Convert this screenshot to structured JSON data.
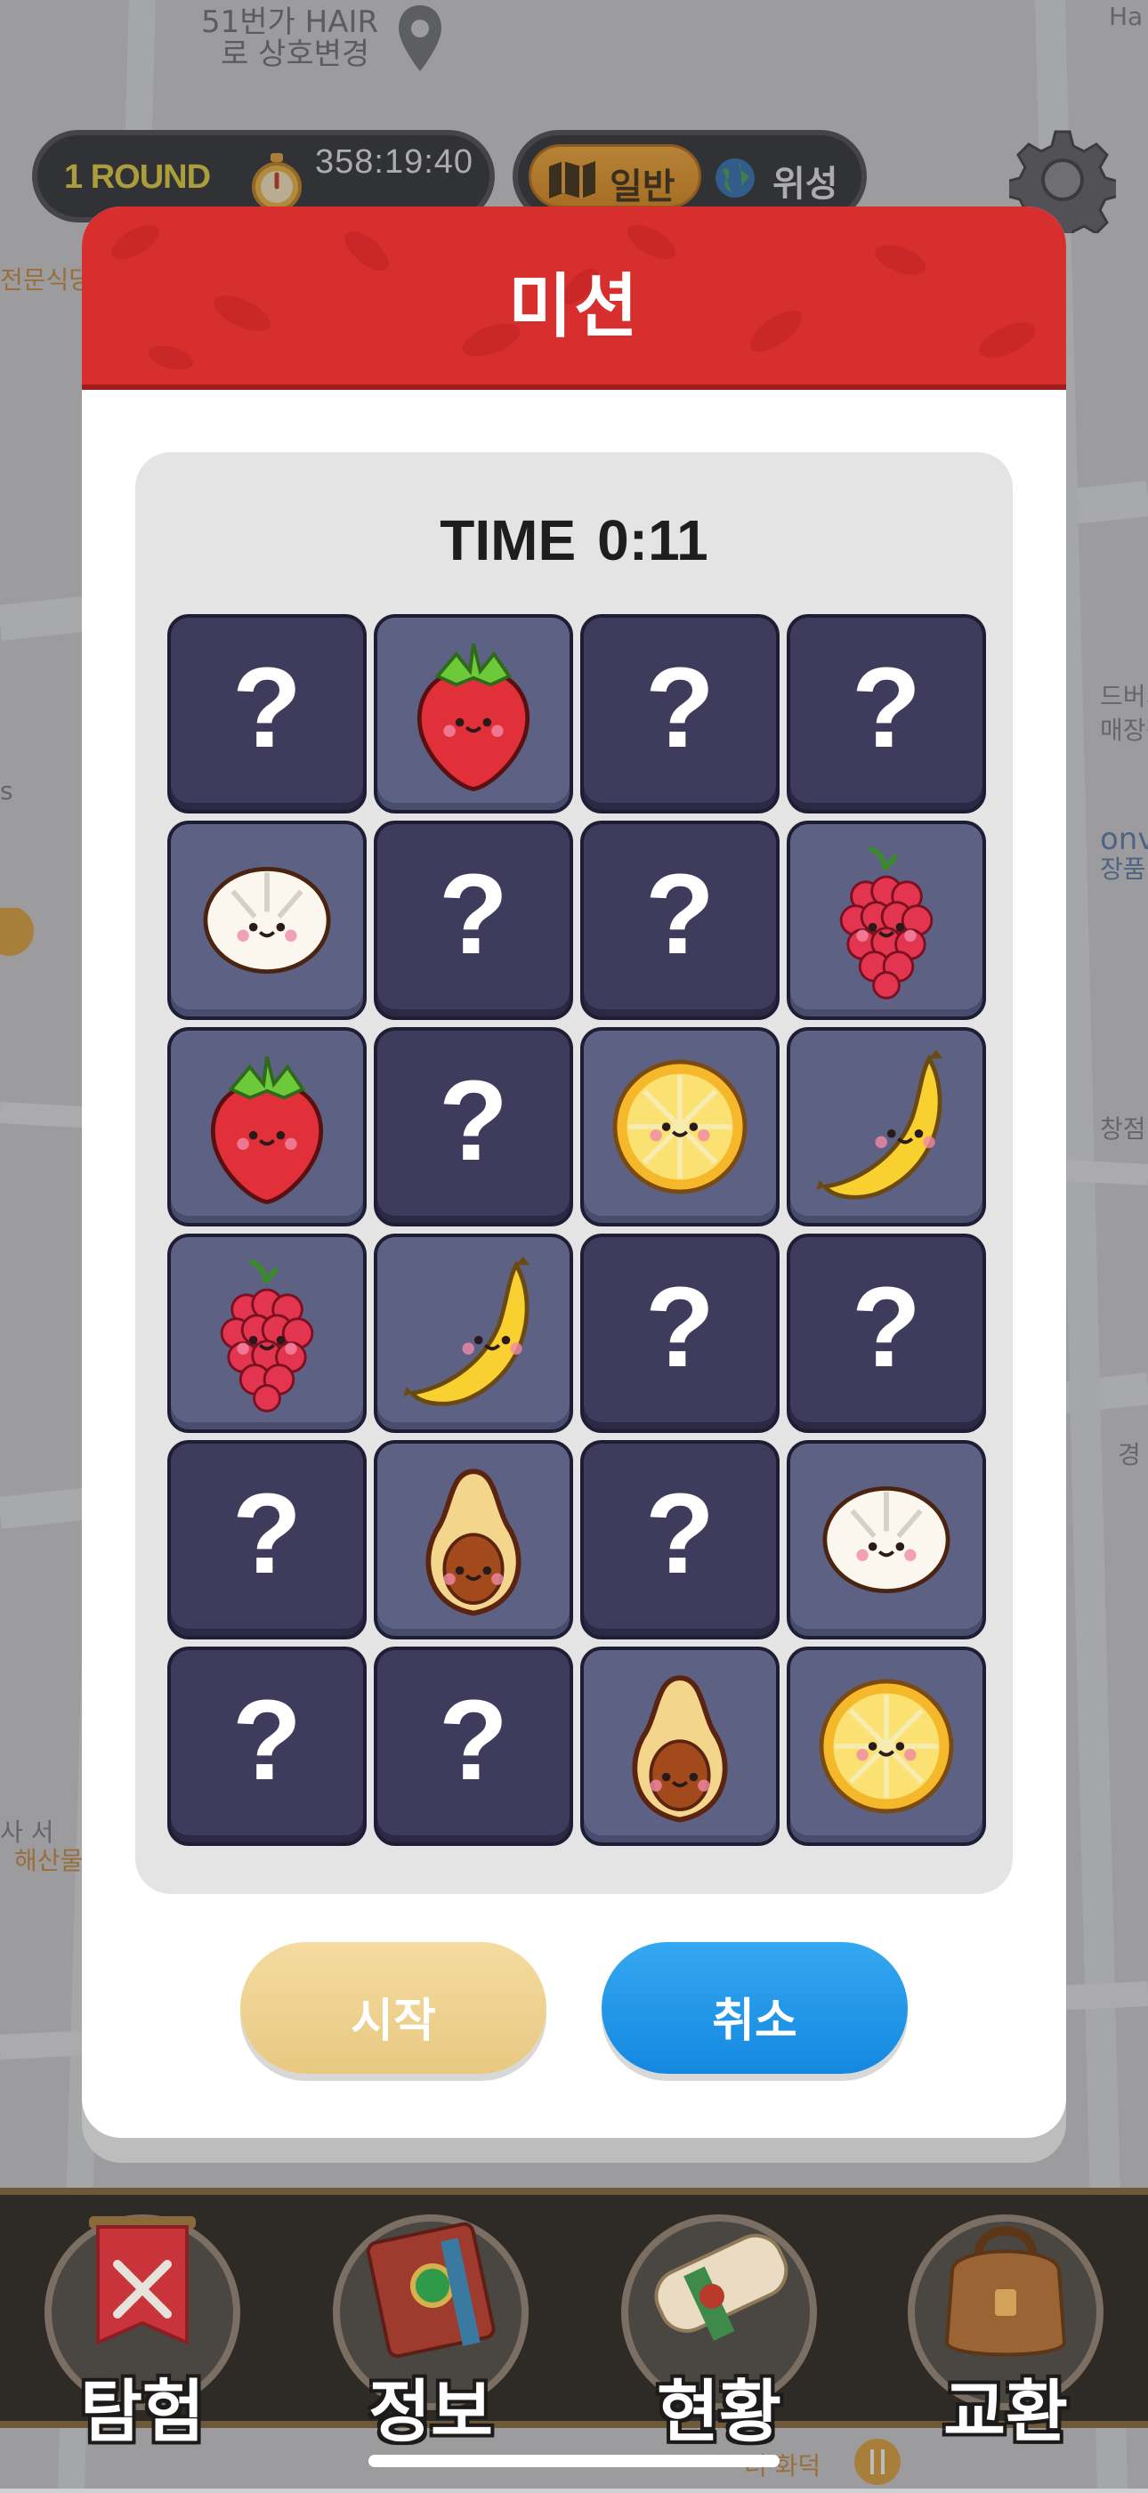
{
  "map": {
    "labels": [
      "51번가 HAIR",
      "로 상호변경",
      "전문식당",
      "드버거",
      "매장점",
      "onvm",
      "장품 판",
      "창점",
      "사 서",
      "해산물",
      "너 화덕",
      "경",
      "s",
      "Ha"
    ]
  },
  "hud": {
    "round_label": "1 ROUND",
    "timer": "358:19:40",
    "mode_normal": "일반",
    "mode_satellite": "위성"
  },
  "modal": {
    "title": "미션",
    "time_label": "TIME",
    "time_value": "0:11",
    "start_label": "시작",
    "cancel_label": "취소"
  },
  "board": {
    "hidden_symbol": "?",
    "tiles": [
      [
        "hidden",
        "strawberry",
        "hidden",
        "hidden"
      ],
      [
        "coconut",
        "hidden",
        "hidden",
        "raspberry"
      ],
      [
        "strawberry",
        "hidden",
        "lemon",
        "banana"
      ],
      [
        "raspberry",
        "banana",
        "hidden",
        "hidden"
      ],
      [
        "hidden",
        "avocado",
        "hidden",
        "coconut"
      ],
      [
        "hidden",
        "hidden",
        "avocado",
        "lemon"
      ]
    ]
  },
  "nav": {
    "items": [
      {
        "label": "탐험",
        "icon": "banner-swords-icon"
      },
      {
        "label": "정보",
        "icon": "book-icon"
      },
      {
        "label": "현황",
        "icon": "scroll-icon"
      },
      {
        "label": "교환",
        "icon": "bag-icon"
      }
    ]
  },
  "colors": {
    "header_red": "#d72e2e",
    "tile_hidden": "#3e3b5c",
    "tile_revealed": "#5d6184",
    "start_button": "#f4dba0",
    "cancel_button": "#1e94e8"
  }
}
